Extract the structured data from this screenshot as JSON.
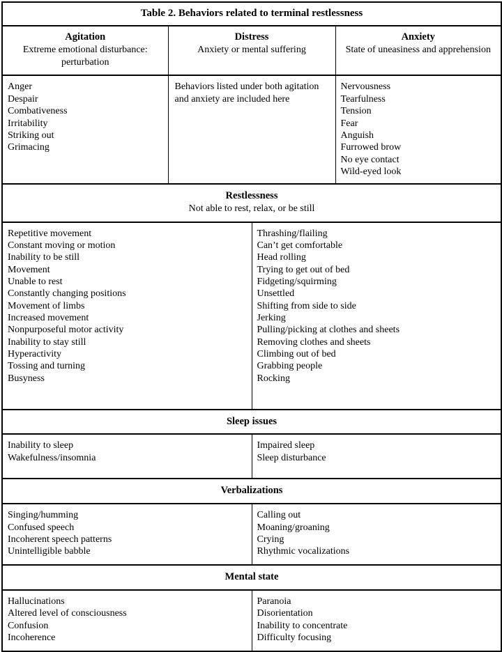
{
  "table": {
    "title": "Table 2. Behaviors related to terminal restlessness",
    "category_headers": [
      {
        "name": "Agitation",
        "description": "Extreme emotional disturbance: perturbation"
      },
      {
        "name": "Distress",
        "description": "Anxiety or mental suffering"
      },
      {
        "name": "Anxiety",
        "description": "State of uneasiness and apprehension"
      }
    ],
    "category_row": {
      "agitation_items": [
        "Anger",
        "Despair",
        "Combativeness",
        "Irritability",
        "Striking out",
        "Grimacing"
      ],
      "distress_note": "Behaviors listed under both agitation and anxiety are included here",
      "anxiety_items": [
        "Nervousness",
        "Tearfulness",
        "Tension",
        "Fear",
        "Anguish",
        "Furrowed brow",
        "No eye contact",
        "Wild-eyed look"
      ]
    },
    "sections": [
      {
        "name": "Restlessness",
        "description": "Not able to rest, relax, or be still",
        "left_items": [
          "Repetitive movement",
          "Constant moving or motion",
          "Inability to be still",
          "Movement",
          "Unable to rest",
          "Constantly changing positions",
          "Movement of limbs",
          "Increased movement",
          "Nonpurposeful motor activity",
          "Inability to stay still",
          "Hyperactivity",
          "Tossing and turning",
          "Busyness"
        ],
        "right_items": [
          "Thrashing/flailing",
          "Can’t get comfortable",
          "Head rolling",
          "Trying to get out of bed",
          "Fidgeting/squirming",
          "Unsettled",
          "Shifting from side to side",
          "Jerking",
          "Pulling/picking at clothes and sheets",
          "Removing clothes and sheets",
          "Climbing out of bed",
          "Grabbing people",
          "Rocking"
        ]
      },
      {
        "name": "Sleep issues",
        "description": "",
        "left_items": [
          "Inability to sleep",
          "Wakefulness/insomnia"
        ],
        "right_items": [
          "Impaired sleep",
          "Sleep disturbance"
        ]
      },
      {
        "name": "Verbalizations",
        "description": "",
        "left_items": [
          "Singing/humming",
          "Confused speech",
          "Incoherent speech patterns",
          "Unintelligible babble"
        ],
        "right_items": [
          "Calling out",
          "Moaning/groaning",
          "Crying",
          "Rhythmic vocalizations"
        ]
      },
      {
        "name": "Mental state",
        "description": "",
        "left_items": [
          "Hallucinations",
          "Altered level of consciousness",
          "Confusion",
          "Incoherence"
        ],
        "right_items": [
          "Paranoia",
          "Disorientation",
          "Inability to concentrate",
          "Difficulty focusing"
        ]
      }
    ]
  }
}
